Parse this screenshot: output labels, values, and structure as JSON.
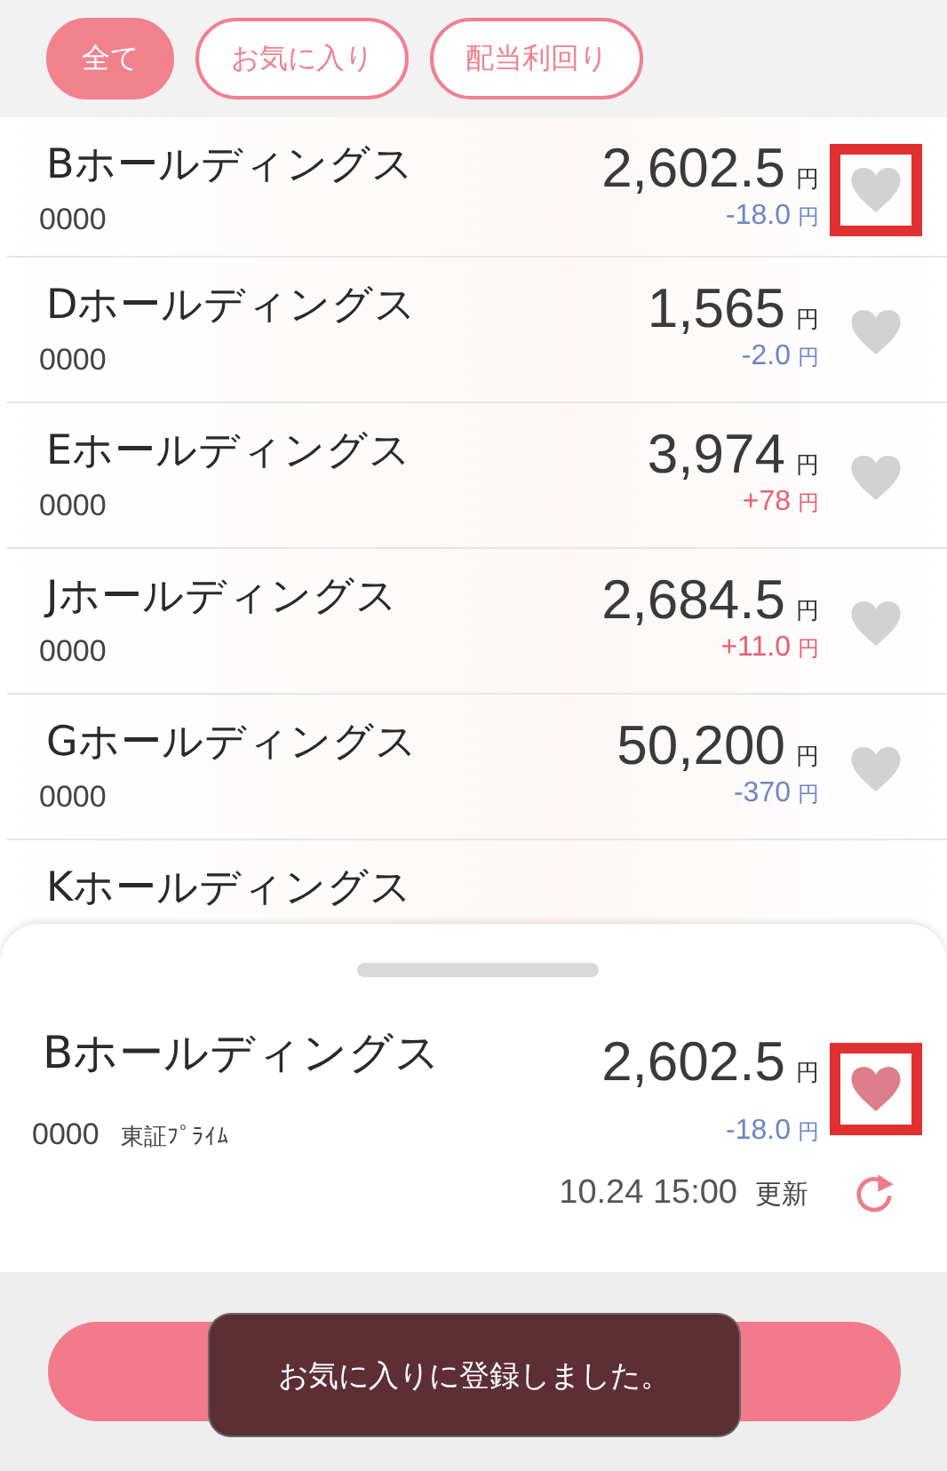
{
  "filters": [
    {
      "label": "全て",
      "selected": true
    },
    {
      "label": "お気に入り",
      "selected": false
    },
    {
      "label": "配当利回り",
      "selected": false
    }
  ],
  "stocks": [
    {
      "name": "Bホールディングス",
      "code": "0000",
      "price": "2,602.5",
      "unit": "円",
      "change": "-18.0",
      "change_unit": "円",
      "color": "#6b86c6",
      "favorite": false,
      "highlighted": true
    },
    {
      "name": "Dホールディングス",
      "code": "0000",
      "price": "1,565",
      "unit": "円",
      "change": "-2.0",
      "change_unit": "円",
      "color": "#6b86c6",
      "favorite": false,
      "highlighted": false
    },
    {
      "name": "Eホールディングス",
      "code": "0000",
      "price": "3,974",
      "unit": "円",
      "change": "+78",
      "change_unit": "円",
      "color": "#e8606e",
      "favorite": false,
      "highlighted": false
    },
    {
      "name": "Jホールディングス",
      "code": "0000",
      "price": "2,684.5",
      "unit": "円",
      "change": "+11.0",
      "change_unit": "円",
      "color": "#e8606e",
      "favorite": false,
      "highlighted": false
    },
    {
      "name": "Gホールディングス",
      "code": "0000",
      "price": "50,200",
      "unit": "円",
      "change": "-370",
      "change_unit": "円",
      "color": "#6b86c6",
      "favorite": false,
      "highlighted": false
    },
    {
      "name": "Kホールディングス"
    }
  ],
  "detail": {
    "name": "Bホールディングス",
    "code": "0000",
    "market": "東証ﾌﾟﾗｲﾑ",
    "price": "2,602.5",
    "unit": "円",
    "change": "-18.0",
    "change_unit": "円",
    "color": "#6b86c6",
    "favorite": true,
    "highlighted": true,
    "updated": "10.24 15:00",
    "update_label": "更新"
  },
  "toast": "お気に入りに登録しました。"
}
